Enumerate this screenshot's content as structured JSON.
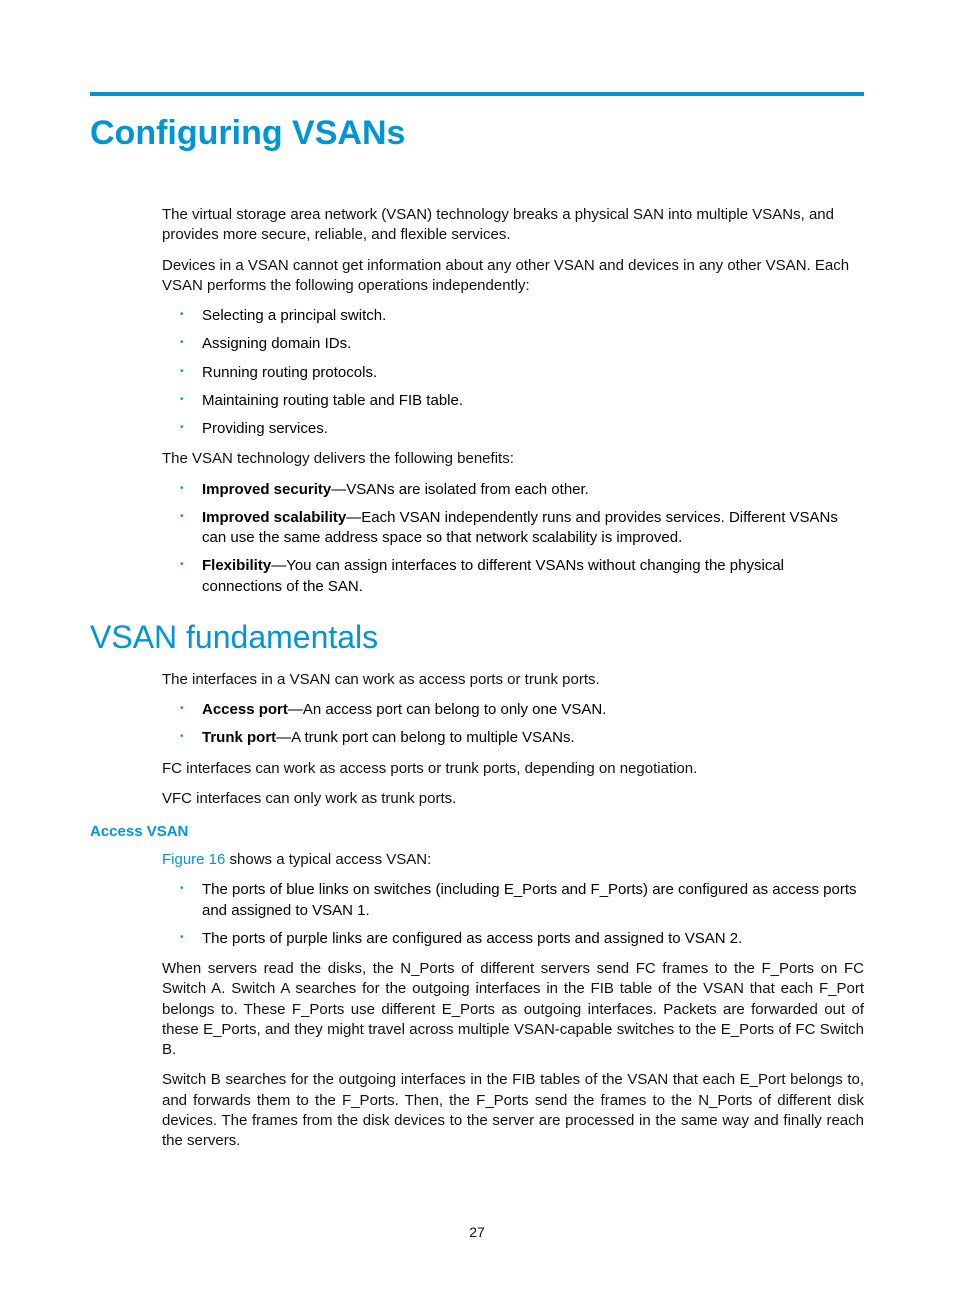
{
  "title": "Configuring VSANs",
  "intro_p1": "The virtual storage area network (VSAN) technology breaks a physical SAN into multiple VSANs, and provides more secure, reliable, and flexible services.",
  "intro_p2": "Devices in a VSAN cannot get information about any other VSAN and devices in any other VSAN. Each VSAN performs the following operations independently:",
  "ops": [
    "Selecting a principal switch.",
    "Assigning domain IDs.",
    "Running routing protocols.",
    "Maintaining routing table and FIB table.",
    "Providing services."
  ],
  "benefits_intro": "The VSAN technology delivers the following benefits:",
  "benefits": [
    {
      "label": "Improved security",
      "text": "—VSANs are isolated from each other."
    },
    {
      "label": "Improved scalability",
      "text": "—Each VSAN independently runs and provides services. Different VSANs can use the same address space so that network scalability is improved."
    },
    {
      "label": "Flexibility",
      "text": "—You can assign interfaces to different VSANs without changing the physical connections of the SAN."
    }
  ],
  "section2": "VSAN fundamentals",
  "fund_p1": "The interfaces in a VSAN can work as access ports or trunk ports.",
  "ports": [
    {
      "label": "Access port",
      "text": "—An access port can belong to only one VSAN."
    },
    {
      "label": "Trunk port",
      "text": "—A trunk port can belong to multiple VSANs."
    }
  ],
  "fund_p2": "FC interfaces can work as access ports or trunk ports, depending on negotiation.",
  "fund_p3": "VFC interfaces can only work as trunk ports.",
  "subhead": "Access VSAN",
  "fig_link": "Figure 16",
  "fig_rest": " shows a typical access VSAN:",
  "access_items": [
    "The ports of blue links on switches (including E_Ports and F_Ports) are configured as access ports and assigned to VSAN 1.",
    "The ports of purple links are configured as access ports and assigned to VSAN 2."
  ],
  "access_p1": "When servers read the disks, the N_Ports of different servers send FC frames to the F_Ports on FC Switch A. Switch A searches for the outgoing interfaces in the FIB table of the VSAN that each F_Port belongs to. These F_Ports use different E_Ports as outgoing interfaces. Packets are forwarded out of these E_Ports, and they might travel across multiple VSAN-capable switches to the E_Ports of FC Switch B.",
  "access_p2": "Switch B searches for the outgoing interfaces in the FIB tables of the VSAN that each E_Port belongs to, and forwards them to the F_Ports. Then, the F_Ports send the frames to the N_Ports of different disk devices. The frames from the disk devices to the server are processed in the same way and finally reach the servers.",
  "page_number": "27"
}
